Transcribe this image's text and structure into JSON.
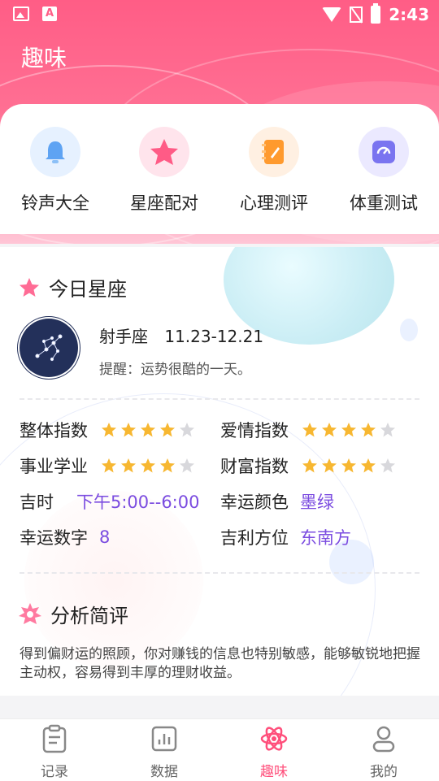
{
  "status_bar": {
    "time": "2:43",
    "icons": [
      "image-icon",
      "font-icon",
      "wifi-icon",
      "sim-none-icon",
      "battery-icon"
    ]
  },
  "app": {
    "title": "趣味"
  },
  "features": [
    {
      "label": "铃声大全",
      "icon": "bell-icon"
    },
    {
      "label": "星座配对",
      "icon": "star-icon"
    },
    {
      "label": "心理测评",
      "icon": "notebook-icon"
    },
    {
      "label": "体重测试",
      "icon": "scale-icon"
    }
  ],
  "today": {
    "title": "今日星座",
    "sign": "射手座",
    "dates": "11.23-12.21",
    "tip": "提醒：运势很酷的一天。"
  },
  "indices": {
    "overall": {
      "label": "整体指数",
      "stars": 4,
      "max": 5
    },
    "love": {
      "label": "爱情指数",
      "stars": 4,
      "max": 5
    },
    "career": {
      "label": "事业学业",
      "stars": 4,
      "max": 5
    },
    "wealth": {
      "label": "财富指数",
      "stars": 4,
      "max": 5
    },
    "lucky_time": {
      "label": "吉时",
      "value": "下午5:00--6:00"
    },
    "lucky_color": {
      "label": "幸运颜色",
      "value": "墨绿"
    },
    "lucky_number": {
      "label": "幸运数字",
      "value": "8"
    },
    "lucky_direction": {
      "label": "吉利方位",
      "value": "东南方"
    }
  },
  "analysis": {
    "title": "分析简评",
    "text": "得到偏财运的照顾，你对赚钱的信息也特别敏感，能够敏锐地把握主动权，容易得到丰厚的理财收益。"
  },
  "nav": [
    {
      "label": "记录",
      "icon": "clipboard-icon",
      "active": false
    },
    {
      "label": "数据",
      "icon": "bar-chart-icon",
      "active": false
    },
    {
      "label": "趣味",
      "icon": "atom-icon",
      "active": true
    },
    {
      "label": "我的",
      "icon": "person-icon",
      "active": false
    }
  ],
  "colors": {
    "accent": "#ff4f7b",
    "value_purple": "#7b4ce0",
    "header_pink": "#ff5d86"
  }
}
